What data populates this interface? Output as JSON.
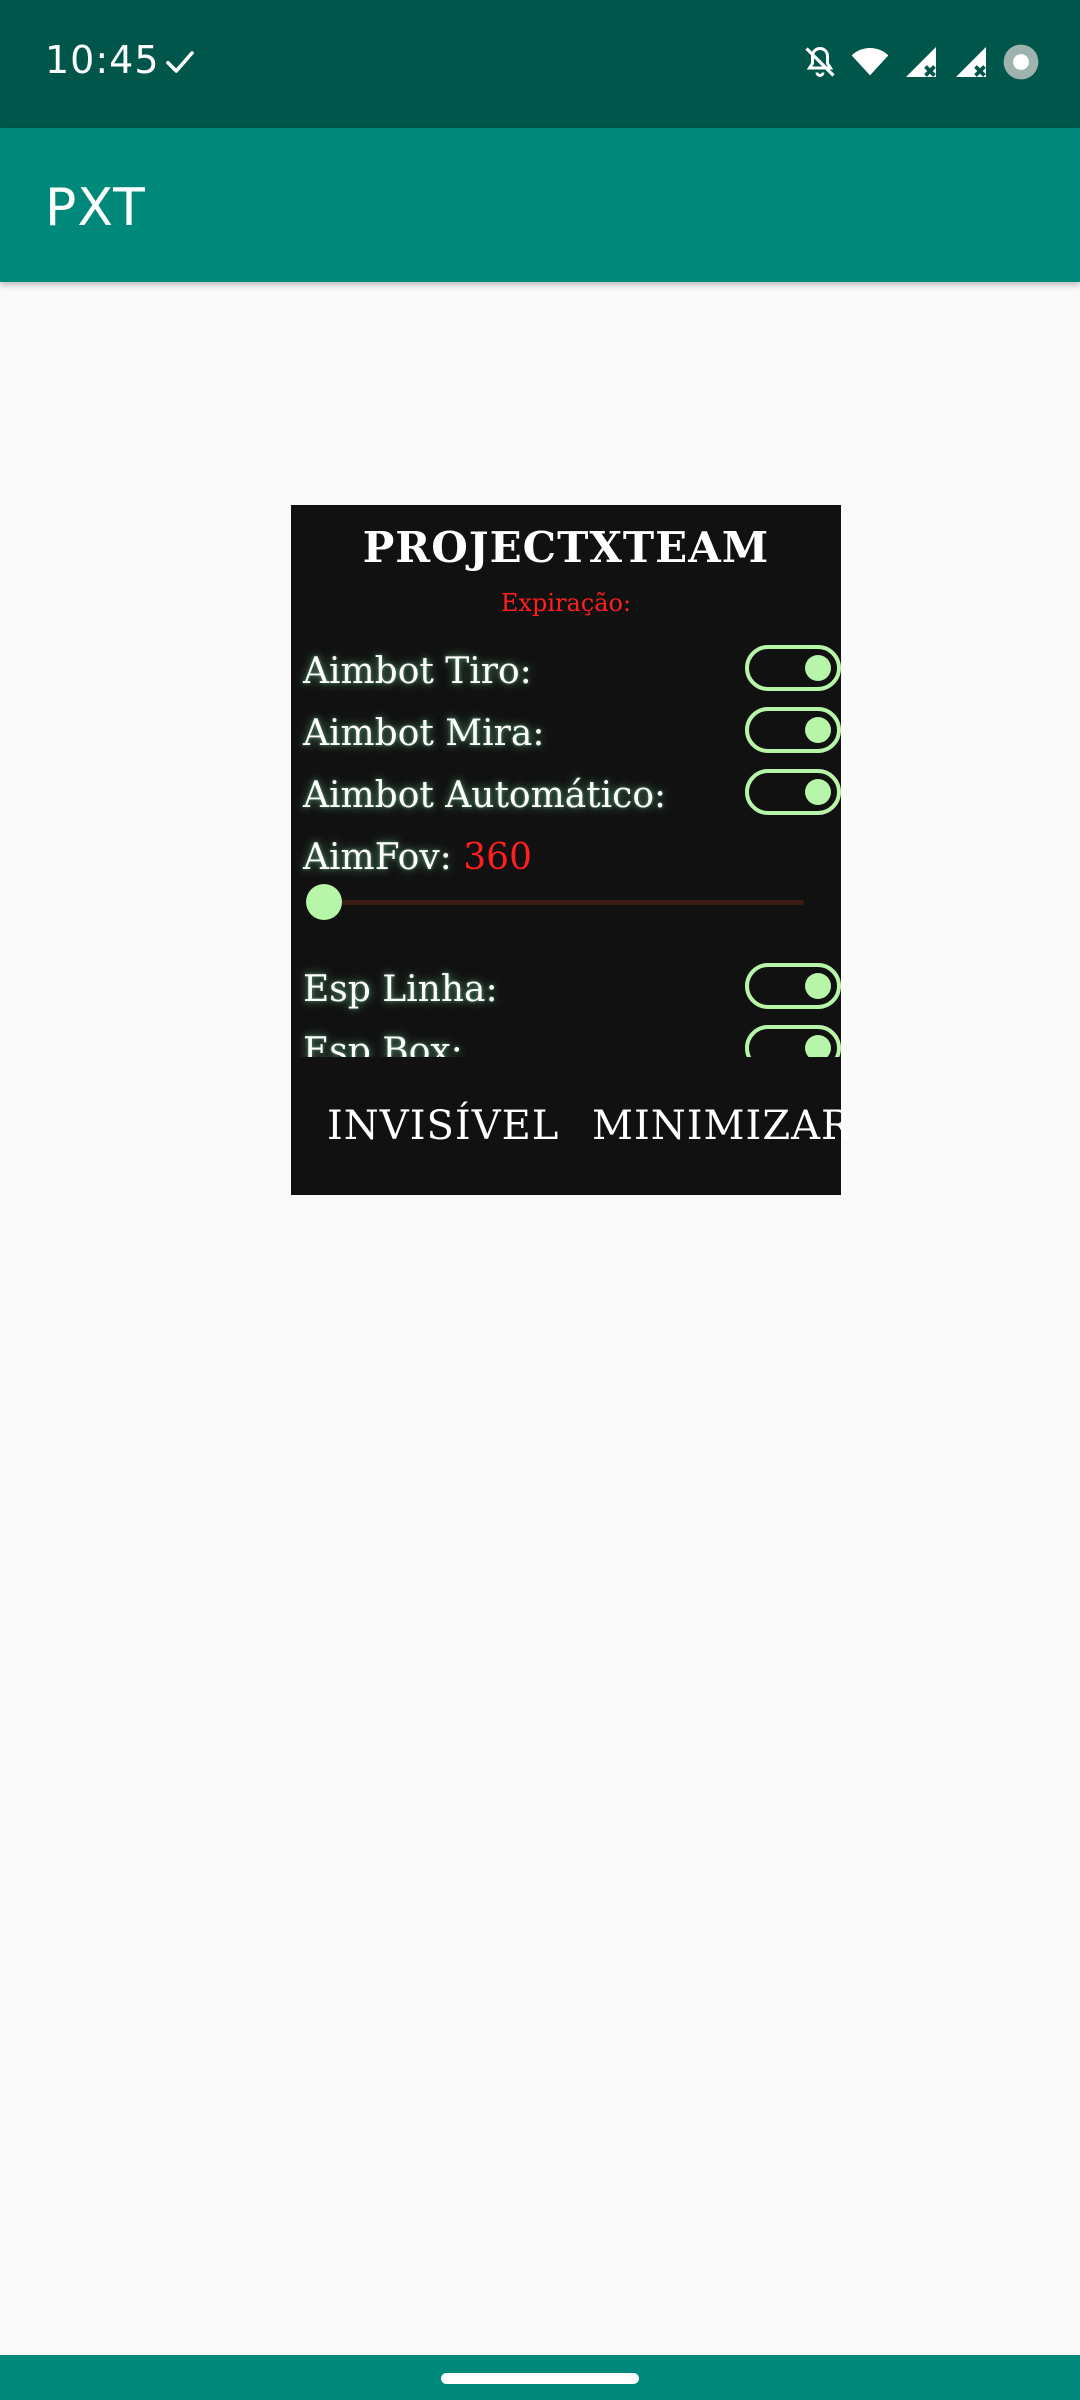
{
  "status_bar": {
    "time": "10:45",
    "icons": [
      "check-icon",
      "bell-off-icon",
      "wifi-icon",
      "signal-x-icon",
      "signal-x-icon",
      "record-dot-icon"
    ]
  },
  "app_bar": {
    "title": "PXT"
  },
  "panel": {
    "title": "PROJECTXTEAM",
    "expiry_label": "Expiração:",
    "toggles": [
      {
        "label": "Aimbot Tiro:",
        "on": true
      },
      {
        "label": "Aimbot Mira:",
        "on": true
      },
      {
        "label": "Aimbot Automático:",
        "on": true
      },
      {
        "label": "Esp Linha:",
        "on": true
      },
      {
        "label": "Esp Box:",
        "on": true
      }
    ],
    "aimfov": {
      "label": "AimFov:",
      "value": "360",
      "slider_fraction": 0.0
    },
    "buttons": {
      "invisible": "INVISÍVEL",
      "minimize": "MINIMIZAR"
    }
  },
  "colors": {
    "status_bar": "#00564a",
    "app_bar": "#00897b",
    "panel_bg": "#111111",
    "accent_green": "#b7f5a8",
    "accent_red": "#ff1f1f"
  }
}
